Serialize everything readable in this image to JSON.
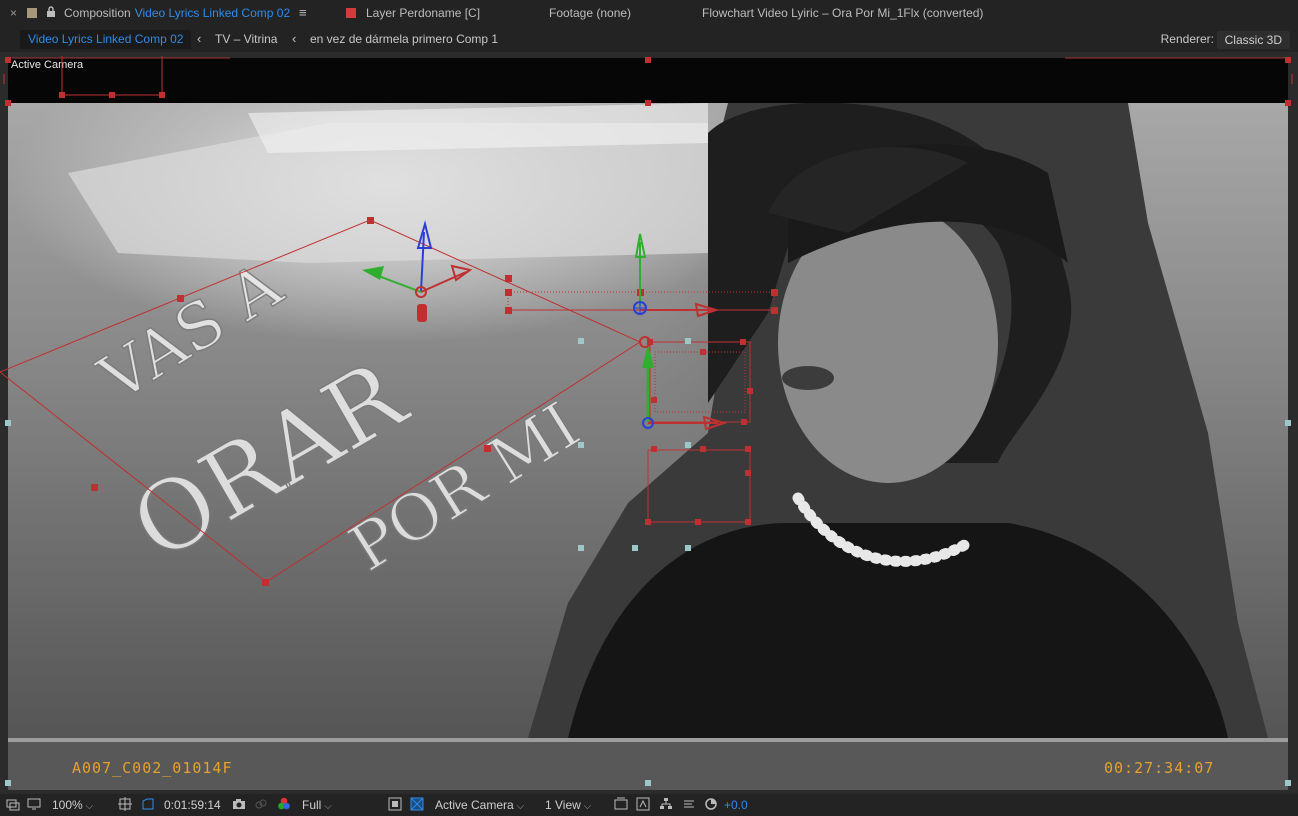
{
  "panel_tabs": {
    "close_glyph": "×",
    "composition_prefix": "Composition",
    "composition_name": "Video Lyrics Linked Comp 02",
    "menu_glyph": "≡",
    "layer_tab": "Layer Perdoname [C]",
    "footage_tab": "Footage (none)",
    "flowchart_tab": "Flowchart Video Lyiric – Ora Por Mi_1Flx (converted)"
  },
  "breadcrumbs": {
    "items": [
      "Video Lyrics Linked Comp 02",
      "TV – Vitrina",
      "en vez  de  dármela  primero Comp 1"
    ],
    "chevron": "‹"
  },
  "renderer": {
    "label": "Renderer:",
    "value": "Classic 3D"
  },
  "viewer": {
    "camera_label": "Active Camera",
    "clip_name": "A007_C002_01014F",
    "timecode": "00:27:34:07",
    "footage_text": [
      "VAS A",
      "ORAR",
      "POR MI"
    ]
  },
  "toolbar": {
    "zoom": "100%",
    "current_time": "0:01:59:14",
    "resolution": "Full",
    "camera_view": "Active Camera",
    "view_layout": "1 View",
    "exposure": "+0.0"
  },
  "colors": {
    "accent_blue": "#2d8ceb",
    "timecode_orange": "#e6a02c",
    "handle_red": "#c03030",
    "panel_bg": "#232323"
  }
}
